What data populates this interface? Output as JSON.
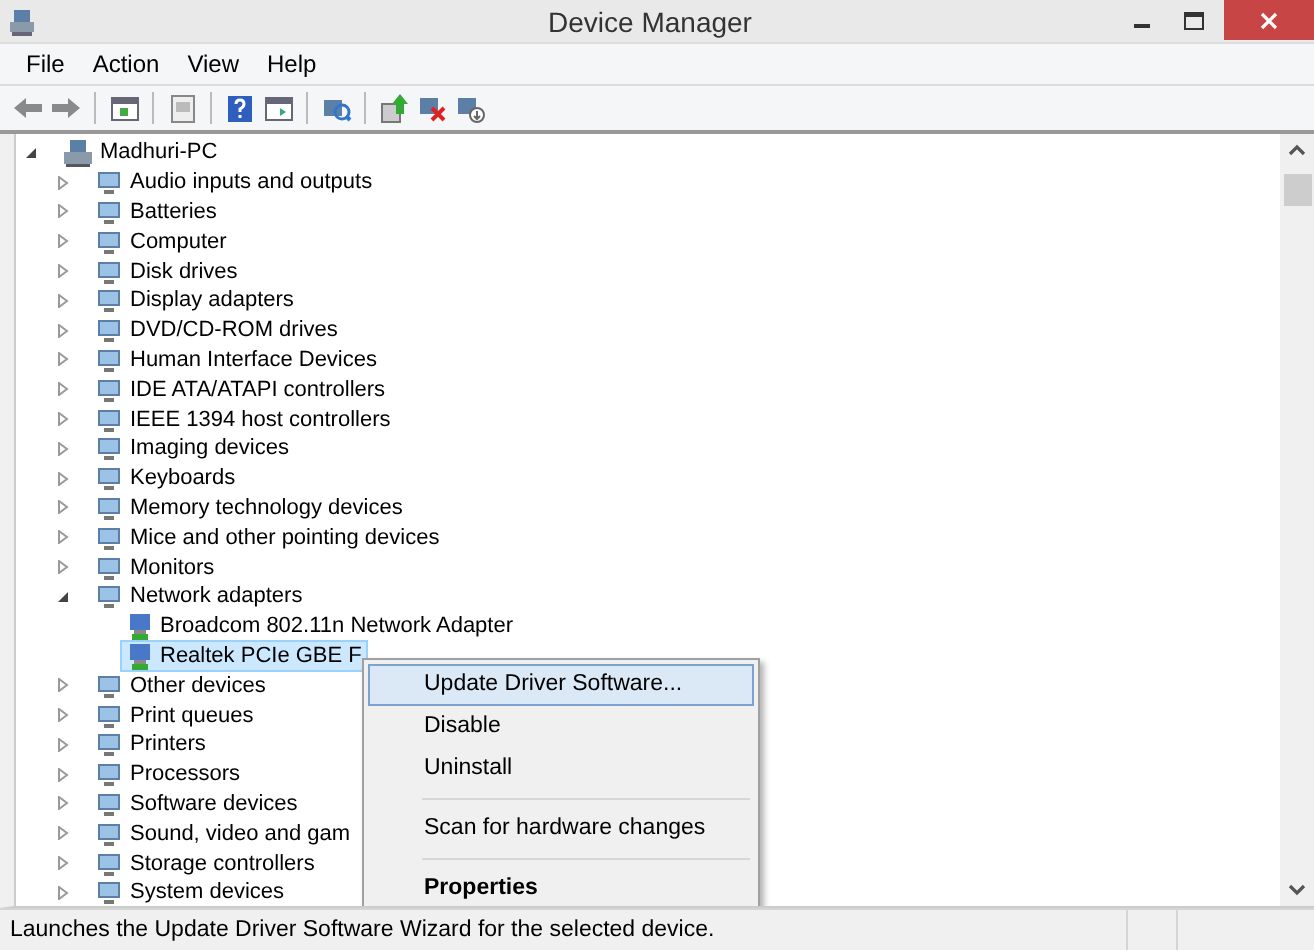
{
  "window": {
    "title": "Device Manager"
  },
  "menu": [
    "File",
    "Action",
    "View",
    "Help"
  ],
  "tree": {
    "label": "Madhuri-PC",
    "expanded": true,
    "selected": false,
    "children": [
      {
        "label": "Audio inputs and outputs",
        "expanded": false,
        "selected": false
      },
      {
        "label": "Batteries",
        "expanded": false,
        "selected": false
      },
      {
        "label": "Computer",
        "expanded": false,
        "selected": false
      },
      {
        "label": "Disk drives",
        "expanded": false,
        "selected": false
      },
      {
        "label": "Display adapters",
        "expanded": false,
        "selected": false
      },
      {
        "label": "DVD/CD-ROM drives",
        "expanded": false,
        "selected": false
      },
      {
        "label": "Human Interface Devices",
        "expanded": false,
        "selected": false
      },
      {
        "label": "IDE ATA/ATAPI controllers",
        "expanded": false,
        "selected": false
      },
      {
        "label": "IEEE 1394 host controllers",
        "expanded": false,
        "selected": false
      },
      {
        "label": "Imaging devices",
        "expanded": false,
        "selected": false
      },
      {
        "label": "Keyboards",
        "expanded": false,
        "selected": false
      },
      {
        "label": "Memory technology devices",
        "expanded": false,
        "selected": false
      },
      {
        "label": "Mice and other pointing devices",
        "expanded": false,
        "selected": false
      },
      {
        "label": "Monitors",
        "expanded": false,
        "selected": false
      },
      {
        "label": "Network adapters",
        "expanded": true,
        "selected": false,
        "children": [
          {
            "label": "Broadcom 802.11n Network Adapter",
            "selected": false
          },
          {
            "label": "Realtek PCIe GBE F",
            "selected": true
          }
        ]
      },
      {
        "label": "Other devices",
        "expanded": false,
        "selected": false
      },
      {
        "label": "Print queues",
        "expanded": false,
        "selected": false
      },
      {
        "label": "Printers",
        "expanded": false,
        "selected": false
      },
      {
        "label": "Processors",
        "expanded": false,
        "selected": false
      },
      {
        "label": "Software devices",
        "expanded": false,
        "selected": false
      },
      {
        "label": "Sound, video and gam",
        "expanded": false,
        "selected": false
      },
      {
        "label": "Storage controllers",
        "expanded": false,
        "selected": false
      },
      {
        "label": "System devices",
        "expanded": false,
        "selected": false
      }
    ]
  },
  "context_menu": [
    {
      "label": "Update Driver Software...",
      "selected": true,
      "bold": false
    },
    {
      "kind": "separator_none",
      "label": "Disable",
      "selected": false,
      "bold": false
    },
    {
      "label": "Uninstall",
      "selected": false,
      "bold": false
    },
    {
      "kind": "separator"
    },
    {
      "label": "Scan for hardware changes",
      "selected": false,
      "bold": false
    },
    {
      "kind": "separator"
    },
    {
      "label": "Properties",
      "selected": false,
      "bold": true
    }
  ],
  "status_bar": "Launches the Update Driver Software Wizard for the selected device."
}
